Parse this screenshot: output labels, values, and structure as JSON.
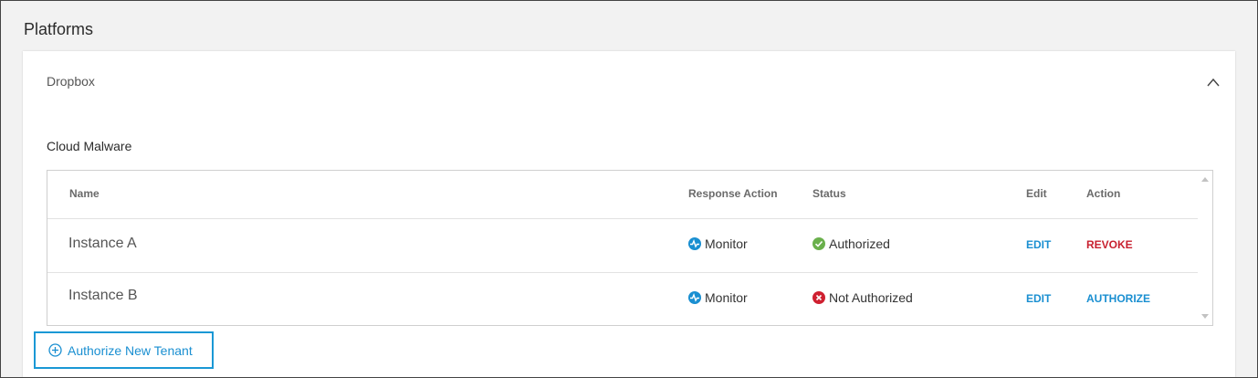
{
  "page": {
    "title": "Platforms"
  },
  "panel": {
    "title": "Dropbox",
    "collapse_icon": "chevron-up-icon",
    "section_title": "Cloud Malware",
    "table": {
      "headers": {
        "name": "Name",
        "response_action": "Response Action",
        "status": "Status",
        "edit": "Edit",
        "action": "Action"
      },
      "rows": [
        {
          "name": "Instance A",
          "response_action": "Monitor",
          "response_icon": "activity-icon",
          "status": "Authorized",
          "status_icon": "check-circle-icon",
          "status_color": "#6ab04c",
          "edit": "EDIT",
          "action": "REVOKE",
          "action_color": "#c8202f"
        },
        {
          "name": "Instance B",
          "response_action": "Monitor",
          "response_icon": "activity-icon",
          "status": "Not Authorized",
          "status_icon": "x-circle-icon",
          "status_color": "#cf2030",
          "edit": "EDIT",
          "action": "AUTHORIZE",
          "action_color": "#1a8fd1"
        }
      ]
    }
  },
  "authorize_button": {
    "label": "Authorize New Tenant",
    "icon": "plus-circle-icon"
  },
  "colors": {
    "accent": "#1a8fd1",
    "danger": "#c8202f",
    "success": "#6ab04c",
    "highlight_border": "#1a98d5"
  }
}
